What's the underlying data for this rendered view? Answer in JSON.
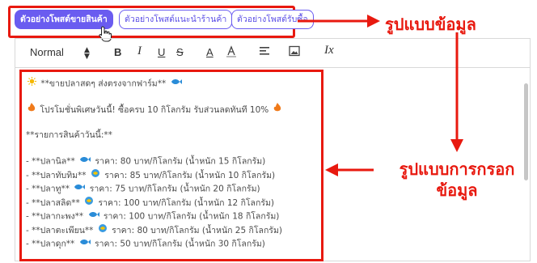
{
  "tabs": [
    {
      "label": "ตัวอย่างโพสต์ขายสินค้า",
      "active": true
    },
    {
      "label": "ตัวอย่างโพสต์แนะนำร้านค้า",
      "active": false
    },
    {
      "label": "ตัวอย่างโพสต์รับซื้อ",
      "active": false
    }
  ],
  "toolbar": {
    "format_select": "Normal",
    "bold": "B",
    "italic": "I",
    "underline": "U",
    "strike": "S",
    "color": "A",
    "clear": "Ix"
  },
  "content": {
    "line1": "**ขายปลาสดๆ ส่งตรงจากฟาร์ม**",
    "line2": "โปรโมชั่นพิเศษวันนี้! ซื้อครบ 10 กิโลกรัม รับส่วนลดทันที 10%",
    "line3": "**รายการสินค้าวันนี้:**",
    "items": [
      {
        "name": "- **ปลานิล**",
        "detail": "ราคา: 80 บาท/กิโลกรัม (น้ำหนัก 15 กิโลกรัม)"
      },
      {
        "name": "- **ปลาทับทิม**",
        "detail": "ราคา: 85 บาท/กิโลกรัม (น้ำหนัก 10 กิโลกรัม)"
      },
      {
        "name": "- **ปลาทู**",
        "detail": "ราคา: 75 บาท/กิโลกรัม (น้ำหนัก 20 กิโลกรัม)"
      },
      {
        "name": "- **ปลาสลิด**",
        "detail": "ราคา: 100 บาท/กิโลกรัม (น้ำหนัก 12 กิโลกรัม)"
      },
      {
        "name": "- **ปลากะพง**",
        "detail": "ราคา: 100 บาท/กิโลกรัม (น้ำหนัก 18 กิโลกรัม)"
      },
      {
        "name": "- **ปลาตะเพียน**",
        "detail": "ราคา: 80 บาท/กิโลกรัม (น้ำหนัก 25 กิโลกรัม)"
      },
      {
        "name": "- **ปลาดุก**",
        "detail": "ราคา: 50 บาท/กิโลกรัม (น้ำหนัก 30 กิโลกรัม)"
      }
    ]
  },
  "annotations": {
    "top": "รูปแบบข้อมูล",
    "mid_line1": "รูปแบบการกรอก",
    "mid_line2": "ข้อมูล"
  },
  "colors": {
    "accent": "#6a5cf0",
    "annotation": "#e8190f"
  }
}
